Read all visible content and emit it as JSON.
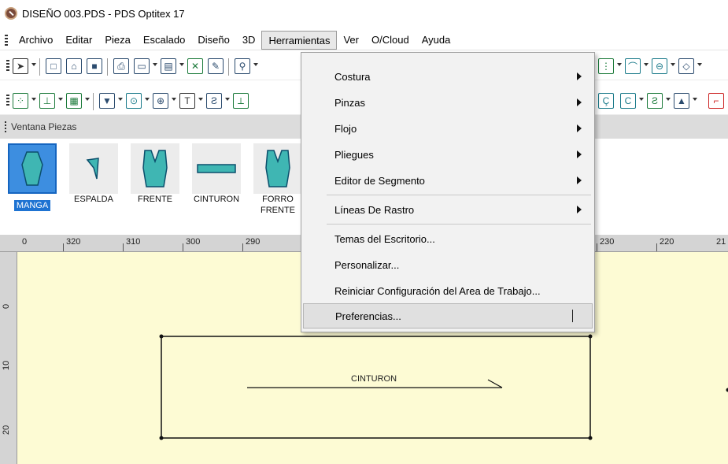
{
  "window": {
    "title": "DISEÑO 003.PDS - PDS Optitex 17"
  },
  "menubar": {
    "items": [
      {
        "label": "Archivo"
      },
      {
        "label": "Editar"
      },
      {
        "label": "Pieza"
      },
      {
        "label": "Escalado"
      },
      {
        "label": "Diseño"
      },
      {
        "label": "3D"
      },
      {
        "label": "Herramientas",
        "active": true
      },
      {
        "label": "Ver"
      },
      {
        "label": "O/Cloud"
      },
      {
        "label": "Ayuda"
      }
    ]
  },
  "dropdown": {
    "items": [
      {
        "label": "Costura",
        "submenu": true
      },
      {
        "label": "Pinzas",
        "submenu": true
      },
      {
        "label": "Flojo",
        "submenu": true
      },
      {
        "label": "Pliegues",
        "submenu": true
      },
      {
        "label": "Editor de Segmento",
        "submenu": true
      },
      {
        "label": "Líneas De Rastro",
        "submenu": true
      },
      {
        "label": "Temas del Escritorio...",
        "submenu": false
      },
      {
        "label": "Personalizar...",
        "submenu": false
      },
      {
        "label": "Reiniciar Configuración del Area de Trabajo...",
        "submenu": false
      },
      {
        "label": "Preferencias...",
        "submenu": false,
        "hover": true
      }
    ]
  },
  "pieces_window": {
    "title": "Ventana Piezas",
    "pieces": [
      {
        "label": "MANGA",
        "selected": true
      },
      {
        "label": "ESPALDA"
      },
      {
        "label": "FRENTE"
      },
      {
        "label": "CINTURON"
      },
      {
        "label": "FORRO FRENTE"
      }
    ]
  },
  "ruler": {
    "labels": [
      "0",
      "320",
      "310",
      "300",
      "290",
      "230",
      "220",
      "21"
    ],
    "vertical_labels": [
      "0",
      "10",
      "20"
    ]
  },
  "canvas": {
    "piece_label": "CINTURON"
  },
  "colors": {
    "canvas_bg": "#fdfbd4",
    "selection": "#1e73d2",
    "piece_fill": "#3fb6b3"
  }
}
